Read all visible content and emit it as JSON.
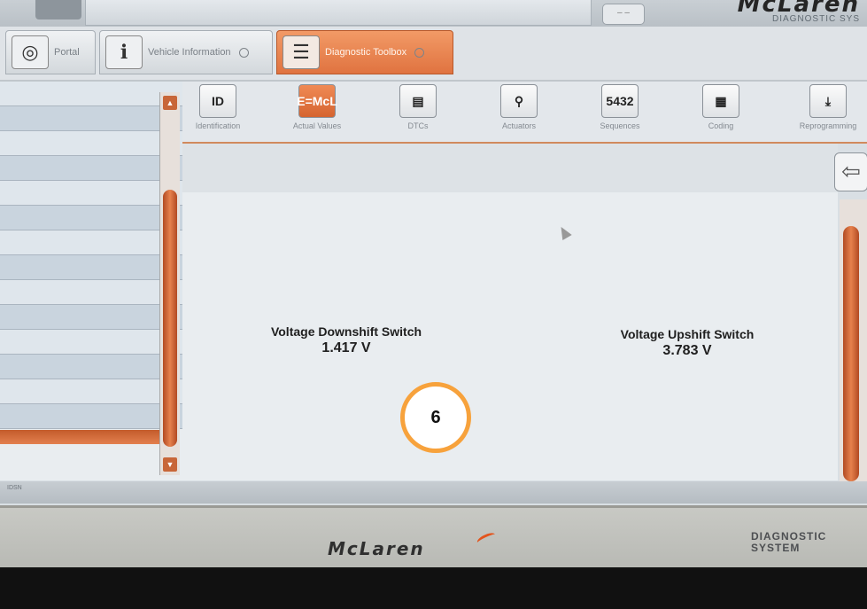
{
  "brand": {
    "logo": "McLaren",
    "subtitle": "DIAGNOSTIC SYS"
  },
  "top": {
    "pill": "– –"
  },
  "tabs": [
    {
      "label": "Portal",
      "icon": "portal-icon"
    },
    {
      "label": "Vehicle Information",
      "icon": "vehicle-info-icon"
    },
    {
      "label": "Diagnostic Toolbox",
      "icon": "toolbox-icon"
    }
  ],
  "toolbar": [
    {
      "label": "Identification",
      "glyph": "ID"
    },
    {
      "label": "Actual Values",
      "glyph": "E=McL"
    },
    {
      "label": "DTCs",
      "glyph": "▤"
    },
    {
      "label": "Actuators",
      "glyph": "⚲"
    },
    {
      "label": "Sequences",
      "glyph": "5432"
    },
    {
      "label": "Coding",
      "glyph": "▦"
    },
    {
      "label": "Reprogramming",
      "glyph": "⤓"
    }
  ],
  "values": {
    "left": {
      "label": "Voltage Downshift Switch",
      "value": "1.417 V"
    },
    "right": {
      "label": "Voltage Upshift Switch",
      "value": "3.783 V"
    }
  },
  "status": {
    "text": "IDSN"
  },
  "bezel": {
    "logo": "McLaren",
    "sub1": "DIAGNOSTIC",
    "sub2": "SYSTEM"
  },
  "annotation": {
    "number": "6"
  },
  "colors": {
    "accent": "#e07340",
    "screen": "#e9edf0"
  }
}
